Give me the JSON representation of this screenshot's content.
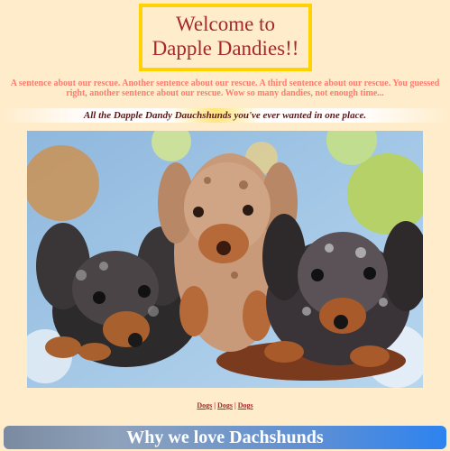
{
  "header": {
    "title_line1": "Welcome to",
    "title_line2": "Dapple Dandies!!"
  },
  "intro": {
    "text": "A sentence about our rescue. Another sentence about our rescue. A third sentence about our rescue. You guessed right, another sentence about our rescue. Wow so many dandies, not enough time..."
  },
  "tagline": {
    "text": "All the Dapple Dandy Dauchshunds you've ever wanted in one place."
  },
  "photo": {
    "description_icon": "puppies-photo"
  },
  "links": {
    "items": [
      "Dogs",
      "Dogs",
      "Dogs"
    ],
    "separator": "|"
  },
  "section": {
    "heading": "Why we love Dachshunds"
  },
  "colors": {
    "background": "#ffeccb",
    "title_border": "#ffd200",
    "title_text": "#a52a2a",
    "intro_text": "#ff7b6e",
    "bar_start": "#7a8aa0",
    "bar_end": "#2d83f0"
  }
}
